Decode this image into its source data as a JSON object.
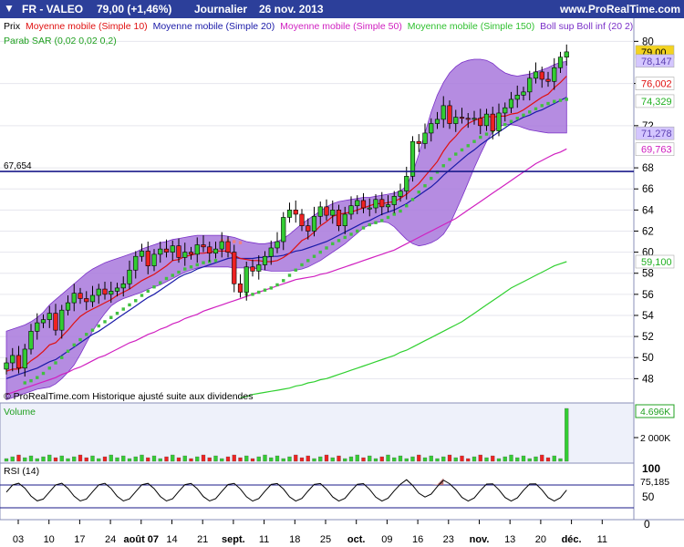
{
  "header": {
    "instrument": "FR - VALEO",
    "price": "79,00 (+1,46%)",
    "period": "Journalier",
    "date": "26 nov. 2013",
    "site": "www.ProRealTime.com",
    "arrow": "▼"
  },
  "legend": {
    "prix": "Prix",
    "mm10": "Moyenne mobile (Simple 10)",
    "mm20": "Moyenne mobile (Simple 20)",
    "mm50": "Moyenne mobile (Simple 50)",
    "mm150": "Moyenne mobile (Simple 150)",
    "boll": "Boll sup Boll inf (20 2)",
    "sar": "Parab SAR (0,02 0,02 0,2)"
  },
  "hline_label": "67,654",
  "copyright": "© ProRealTime.com Historique ajusté suite aux dividendes",
  "volume_panel": {
    "label": "Volume",
    "tick": "2 000K",
    "value_tag": "4.696K"
  },
  "rsi_panel": {
    "label": "RSI (14)",
    "ticks": [
      "100",
      "50",
      "0"
    ],
    "value_tag": "75,185"
  },
  "price_tags": [
    {
      "text": "79,00",
      "value": 79.0,
      "color": "#f3d31f",
      "fg": "#000"
    },
    {
      "text": "78,147",
      "value": 78.147,
      "color": "#d4c6ff",
      "fg": "#5b3fb0"
    },
    {
      "text": "76,002",
      "value": 76.002,
      "color": "#ffffff",
      "fg": "#e01010"
    },
    {
      "text": "74,329",
      "value": 74.329,
      "color": "#ffffff",
      "fg": "#20b020"
    },
    {
      "text": "71,278",
      "value": 71.278,
      "color": "#d4c6ff",
      "fg": "#5b3fb0"
    },
    {
      "text": "69,763",
      "value": 69.763,
      "color": "#ffffff",
      "fg": "#d020c0"
    },
    {
      "text": "59,100",
      "value": 59.1,
      "color": "#ffffff",
      "fg": "#20b020"
    }
  ],
  "chart_data": {
    "type": "candlestick",
    "y_ticks": [
      80,
      76,
      72,
      68,
      66,
      64,
      62,
      60,
      58,
      56,
      54,
      52,
      50,
      48
    ],
    "ylim": [
      46,
      82
    ],
    "hline": 67.654,
    "x_ticks": [
      "03",
      "10",
      "17",
      "24",
      "août 07",
      "14",
      "21",
      "sept.",
      "11",
      "18",
      "25",
      "oct.",
      "09",
      "16",
      "23",
      "nov.",
      "13",
      "20",
      "déc.",
      "11"
    ],
    "close": [
      49.5,
      50.2,
      49.0,
      50.8,
      52.5,
      53.3,
      53.6,
      54.2,
      52.6,
      54.5,
      55.2,
      56.1,
      55.6,
      55.3,
      55.9,
      56.5,
      56.0,
      56.3,
      56.6,
      57.0,
      58.3,
      59.6,
      60.1,
      58.7,
      59.8,
      60.3,
      60.0,
      60.6,
      59.5,
      60.0,
      59.8,
      60.7,
      60.5,
      59.9,
      60.3,
      61.0,
      60.0,
      57.0,
      56.2,
      58.6,
      58.2,
      58.8,
      59.6,
      60.4,
      61.0,
      63.3,
      64.0,
      63.6,
      62.5,
      62.0,
      63.4,
      64.3,
      63.5,
      64.0,
      62.5,
      63.6,
      64.4,
      64.9,
      64.2,
      64.2,
      65.0,
      64.3,
      64.5,
      65.3,
      65.8,
      67.2,
      70.5,
      70.3,
      71.3,
      72.2,
      72.6,
      73.9,
      72.2,
      72.8,
      72.7,
      72.6,
      72.7,
      72.0,
      73.1,
      71.5,
      73.2,
      73.7,
      74.5,
      74.9,
      75.2,
      76.5,
      77.1,
      76.4,
      76.2,
      77.5,
      78.5,
      79.0
    ],
    "sma10": [
      48.7,
      48.9,
      48.9,
      49.2,
      49.7,
      50.1,
      50.6,
      51.2,
      51.4,
      52.0,
      52.6,
      53.3,
      53.9,
      54.3,
      54.6,
      54.9,
      55.2,
      55.5,
      55.9,
      56.2,
      56.5,
      56.9,
      57.3,
      57.6,
      57.9,
      58.3,
      58.7,
      59.2,
      59.3,
      59.6,
      59.7,
      59.9,
      59.9,
      60.0,
      60.1,
      60.1,
      60.1,
      59.7,
      59.4,
      59.3,
      59.2,
      59.2,
      59.1,
      59.1,
      59.2,
      59.5,
      59.9,
      60.5,
      61.1,
      61.4,
      61.9,
      62.5,
      62.9,
      63.4,
      63.6,
      63.7,
      63.8,
      64.0,
      64.2,
      64.4,
      64.6,
      64.6,
      64.7,
      64.8,
      65.1,
      65.5,
      66.0,
      66.5,
      67.2,
      67.9,
      68.6,
      69.6,
      70.4,
      71.0,
      71.7,
      72.2,
      72.5,
      72.7,
      72.9,
      72.8,
      72.9,
      72.9,
      73.1,
      73.2,
      73.5,
      73.9,
      74.3,
      74.7,
      75.0,
      75.6,
      76.1,
      76.7
    ],
    "sma20": [
      48.0,
      48.2,
      48.4,
      48.6,
      48.8,
      49.0,
      49.3,
      49.6,
      49.8,
      50.2,
      50.6,
      51.0,
      51.4,
      51.8,
      52.2,
      52.5,
      52.9,
      53.3,
      53.7,
      54.1,
      54.5,
      54.9,
      55.3,
      55.7,
      56.0,
      56.4,
      56.8,
      57.2,
      57.6,
      57.9,
      58.1,
      58.4,
      58.6,
      58.8,
      59.0,
      59.2,
      59.4,
      59.5,
      59.4,
      59.4,
      59.4,
      59.5,
      59.5,
      59.6,
      59.6,
      59.7,
      59.9,
      60.1,
      60.2,
      60.4,
      60.6,
      60.8,
      61.0,
      61.3,
      61.6,
      61.9,
      62.2,
      62.5,
      62.8,
      63.0,
      63.3,
      63.6,
      63.8,
      64.0,
      64.3,
      64.6,
      65.0,
      65.4,
      65.8,
      66.2,
      66.7,
      67.3,
      67.8,
      68.3,
      68.8,
      69.3,
      69.7,
      70.2,
      70.6,
      71.0,
      71.4,
      71.8,
      72.2,
      72.5,
      72.8,
      73.0,
      73.3,
      73.5,
      73.8,
      74.1,
      74.4,
      74.7
    ],
    "sma50": [
      46.5,
      46.7,
      46.9,
      47.1,
      47.3,
      47.5,
      47.7,
      47.9,
      48.1,
      48.4,
      48.6,
      48.9,
      49.1,
      49.4,
      49.7,
      50.0,
      50.2,
      50.5,
      50.8,
      51.1,
      51.4,
      51.6,
      51.9,
      52.2,
      52.4,
      52.7,
      52.9,
      53.2,
      53.4,
      53.7,
      53.9,
      54.1,
      54.4,
      54.6,
      54.8,
      55.0,
      55.2,
      55.4,
      55.6,
      55.8,
      56.0,
      56.2,
      56.4,
      56.6,
      56.8,
      57.0,
      57.2,
      57.4,
      57.5,
      57.6,
      57.7,
      57.9,
      58.0,
      58.2,
      58.4,
      58.6,
      58.8,
      59.0,
      59.2,
      59.4,
      59.6,
      59.8,
      60.0,
      60.2,
      60.5,
      60.8,
      61.1,
      61.4,
      61.7,
      62.0,
      62.3,
      62.6,
      62.9,
      63.2,
      63.6,
      64.0,
      64.4,
      64.8,
      65.2,
      65.6,
      66.0,
      66.4,
      66.8,
      67.2,
      67.6,
      68.0,
      68.4,
      68.7,
      69.0,
      69.3,
      69.5,
      69.8
    ],
    "sma150": [
      null,
      null,
      null,
      null,
      null,
      null,
      null,
      null,
      null,
      null,
      null,
      null,
      null,
      null,
      null,
      null,
      null,
      null,
      null,
      null,
      null,
      null,
      null,
      null,
      null,
      null,
      null,
      null,
      null,
      null,
      null,
      null,
      null,
      null,
      null,
      null,
      null,
      null,
      46.2,
      46.3,
      46.5,
      46.6,
      46.7,
      46.8,
      46.9,
      47.0,
      47.1,
      47.3,
      47.4,
      47.6,
      47.7,
      47.9,
      48.0,
      48.2,
      48.4,
      48.6,
      48.8,
      49.0,
      49.2,
      49.4,
      49.6,
      49.8,
      50.0,
      50.2,
      50.5,
      50.7,
      51.0,
      51.3,
      51.6,
      51.9,
      52.2,
      52.5,
      52.8,
      53.1,
      53.4,
      53.8,
      54.2,
      54.6,
      55.0,
      55.4,
      55.8,
      56.2,
      56.6,
      56.9,
      57.2,
      57.5,
      57.8,
      58.1,
      58.4,
      58.7,
      58.9,
      59.1
    ],
    "boll_up": [
      52.5,
      52.7,
      52.9,
      53.1,
      53.4,
      53.8,
      54.3,
      55.0,
      55.5,
      56.0,
      56.5,
      57.0,
      57.5,
      58.0,
      58.4,
      58.7,
      59.0,
      59.2,
      59.4,
      59.6,
      59.8,
      60.0,
      60.3,
      60.5,
      60.7,
      60.9,
      61.0,
      61.2,
      61.3,
      61.4,
      61.5,
      61.6,
      61.6,
      61.6,
      61.6,
      61.6,
      61.5,
      61.4,
      61.2,
      61.0,
      60.9,
      60.8,
      60.8,
      60.9,
      61.0,
      61.3,
      61.7,
      62.2,
      62.7,
      63.1,
      63.5,
      63.9,
      64.3,
      64.6,
      64.8,
      64.9,
      65.0,
      65.1,
      65.2,
      65.2,
      65.3,
      65.4,
      65.5,
      65.6,
      65.8,
      66.3,
      67.5,
      69.3,
      71.3,
      73.3,
      74.9,
      76.1,
      77.0,
      77.6,
      78.0,
      78.2,
      78.3,
      78.3,
      78.2,
      77.9,
      77.4,
      77.0,
      76.8,
      76.7,
      76.8,
      76.9,
      77.1,
      77.3,
      77.5,
      77.8,
      78.0,
      78.1
    ],
    "boll_low": [
      46.0,
      46.2,
      46.4,
      46.6,
      46.8,
      47.0,
      47.1,
      47.2,
      47.5,
      48.0,
      48.6,
      49.3,
      50.3,
      51.4,
      52.5,
      53.4,
      54.2,
      54.9,
      55.3,
      55.6,
      55.8,
      56.0,
      56.2,
      56.5,
      56.7,
      56.9,
      57.2,
      57.5,
      57.8,
      58.1,
      58.3,
      58.5,
      58.6,
      58.6,
      58.6,
      58.6,
      58.6,
      58.5,
      58.5,
      58.5,
      58.5,
      58.4,
      58.3,
      58.2,
      58.2,
      58.2,
      58.2,
      58.3,
      58.4,
      58.6,
      58.9,
      59.2,
      59.6,
      60.0,
      60.4,
      60.8,
      61.3,
      61.8,
      62.3,
      62.6,
      62.8,
      62.9,
      62.8,
      62.4,
      61.8,
      61.2,
      60.8,
      60.6,
      60.7,
      60.9,
      61.2,
      61.7,
      62.6,
      63.9,
      65.2,
      66.6,
      68.0,
      69.3,
      70.5,
      71.4,
      71.9,
      72.1,
      72.1,
      72.0,
      71.8,
      71.6,
      71.5,
      71.4,
      71.3,
      71.3,
      71.3,
      71.3
    ],
    "sar": [
      null,
      null,
      null,
      47.6,
      47.8,
      48.1,
      48.5,
      49.0,
      49.5,
      50.0,
      50.6,
      51.2,
      51.7,
      52.2,
      52.6,
      53.0,
      53.4,
      53.8,
      54.2,
      54.6,
      55.0,
      55.4,
      55.9,
      56.3,
      56.7,
      57.1,
      57.5,
      57.8,
      58.1,
      58.4,
      58.6,
      58.8,
      59.0,
      59.1,
      59.2,
      61.1,
      61.1,
      61.0,
      60.9,
      56.0,
      56.0,
      56.2,
      56.4,
      56.6,
      56.9,
      57.3,
      57.8,
      58.3,
      58.8,
      59.2,
      59.6,
      60.0,
      60.4,
      60.8,
      61.1,
      61.4,
      61.7,
      62.0,
      62.3,
      62.6,
      62.8,
      63.0,
      63.3,
      63.6,
      63.9,
      64.4,
      65.0,
      65.7,
      66.3,
      67.0,
      67.6,
      68.2,
      68.8,
      69.3,
      69.7,
      70.1,
      70.5,
      70.9,
      71.2,
      71.5,
      71.8,
      72.1,
      72.4,
      72.7,
      73.0,
      73.3,
      73.6,
      73.9,
      74.1,
      74.3,
      74.4,
      74.5
    ],
    "volume_last": 4696
  }
}
